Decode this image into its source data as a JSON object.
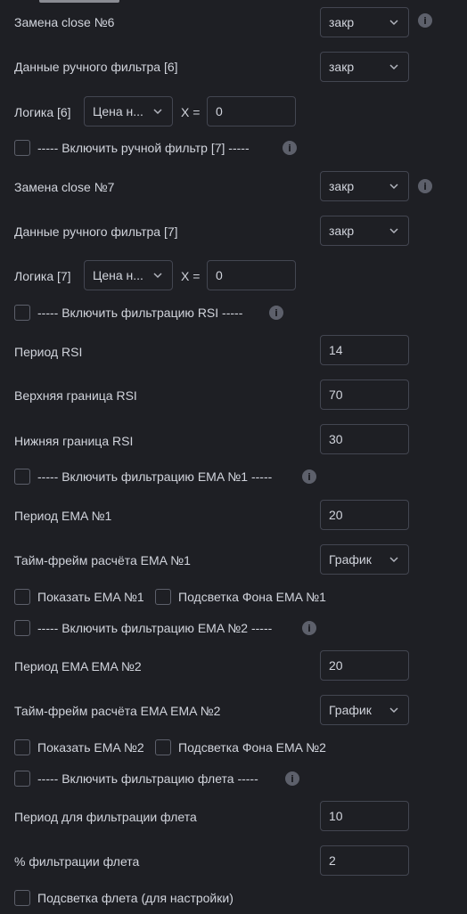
{
  "r1": {
    "label": "Замена close №6",
    "value": "закр"
  },
  "r2": {
    "label": "Данные ручного фильтра [6]",
    "value": "закр"
  },
  "r3": {
    "label": "Логика [6]",
    "select": "Цена н...",
    "xeq": "X =",
    "input": "0"
  },
  "r4": {
    "label": "----- Включить ручной фильтр [7] -----"
  },
  "r5": {
    "label": "Замена close №7",
    "value": "закр"
  },
  "r6": {
    "label": "Данные ручного фильтра [7]",
    "value": "закр"
  },
  "r7": {
    "label": "Логика [7]",
    "select": "Цена н...",
    "xeq": "X =",
    "input": "0"
  },
  "r8": {
    "label": "----- Включить фильтрацию RSI -----"
  },
  "r9": {
    "label": "Период RSI",
    "value": "14"
  },
  "r10": {
    "label": "Верхняя граница RSI",
    "value": "70"
  },
  "r11": {
    "label": "Нижняя граница RSI",
    "value": "30"
  },
  "r12": {
    "label": "----- Включить фильтрацию EMA №1 -----"
  },
  "r13": {
    "label": "Период EMA №1",
    "value": "20"
  },
  "r14": {
    "label": "Тайм-фрейм расчёта EMA №1",
    "value": "График"
  },
  "r15": {
    "label_a": "Показать EMA №1",
    "label_b": "Подсветка Фона EMA №1"
  },
  "r16": {
    "label": "----- Включить фильтрацию EMA №2 -----"
  },
  "r17": {
    "label": "Период EMA EMA №2",
    "value": "20"
  },
  "r18": {
    "label": "Тайм-фрейм расчёта EMA EMA №2",
    "value": "График"
  },
  "r19": {
    "label_a": "Показать EMA №2",
    "label_b": "Подсветка Фона EMA №2"
  },
  "r20": {
    "label": "----- Включить фильтрацию флета -----"
  },
  "r21": {
    "label": "Период для фильтрации флета",
    "value": "10"
  },
  "r22": {
    "label": "% фильтрации флета",
    "value": "2"
  },
  "r23": {
    "label": "Подсветка флета (для настройки)"
  },
  "icons": {
    "info": "info-icon",
    "chevron": "chevron-down-icon"
  },
  "colors": {
    "background": "#1e1f24",
    "text": "#d1d4dc",
    "border": "#434651",
    "muted": "#5d606b"
  }
}
